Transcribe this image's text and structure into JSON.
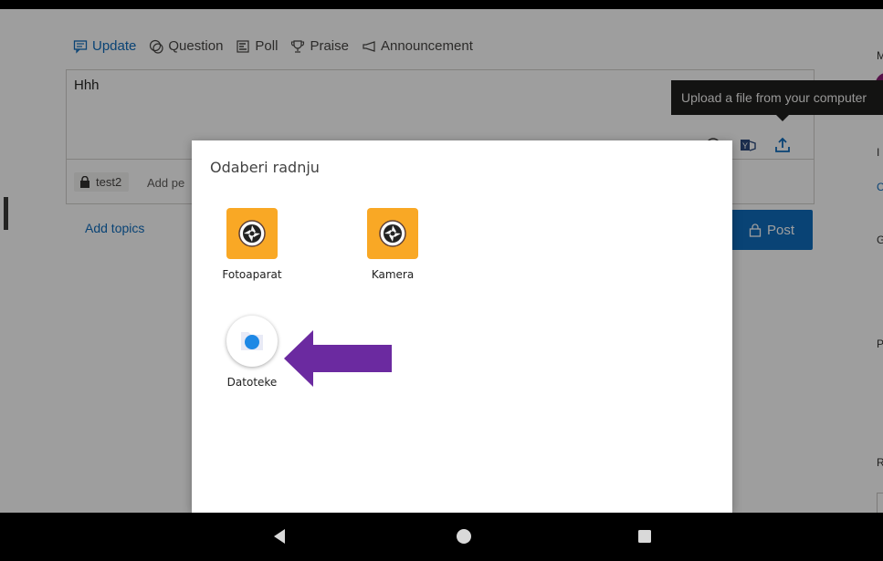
{
  "composer": {
    "tabs": [
      {
        "label": "Update",
        "icon": "message-icon",
        "active": true
      },
      {
        "label": "Question",
        "icon": "question-icon",
        "active": false
      },
      {
        "label": "Poll",
        "icon": "poll-icon",
        "active": false
      },
      {
        "label": "Praise",
        "icon": "trophy-icon",
        "active": false
      },
      {
        "label": "Announcement",
        "icon": "megaphone-icon",
        "active": false
      }
    ],
    "message_text": "Hhh",
    "group_chip": "test2",
    "add_people_text": "Add pe",
    "add_topics_label": "Add topics",
    "post_label": "Post"
  },
  "tooltip": {
    "text": "Upload a file from your computer"
  },
  "right_column": {
    "letters": [
      "M",
      "I",
      "C",
      "G",
      "P",
      "R"
    ]
  },
  "dialog": {
    "title": "Odaberi radnju",
    "apps": [
      {
        "label": "Fotoaparat",
        "icon": "camera-aperture-icon"
      },
      {
        "label": "Kamera",
        "icon": "camera-aperture-icon"
      },
      {
        "label": "Datoteke",
        "icon": "files-icon"
      }
    ]
  },
  "navbar": {
    "buttons": [
      "back-icon",
      "home-icon",
      "recents-icon"
    ]
  },
  "colors": {
    "accent": "#0f6cbd",
    "camera_app": "#f9a825",
    "arrow": "#6b2aa0",
    "files_dot": "#1e88e5",
    "avatar": "#8c1e76"
  }
}
